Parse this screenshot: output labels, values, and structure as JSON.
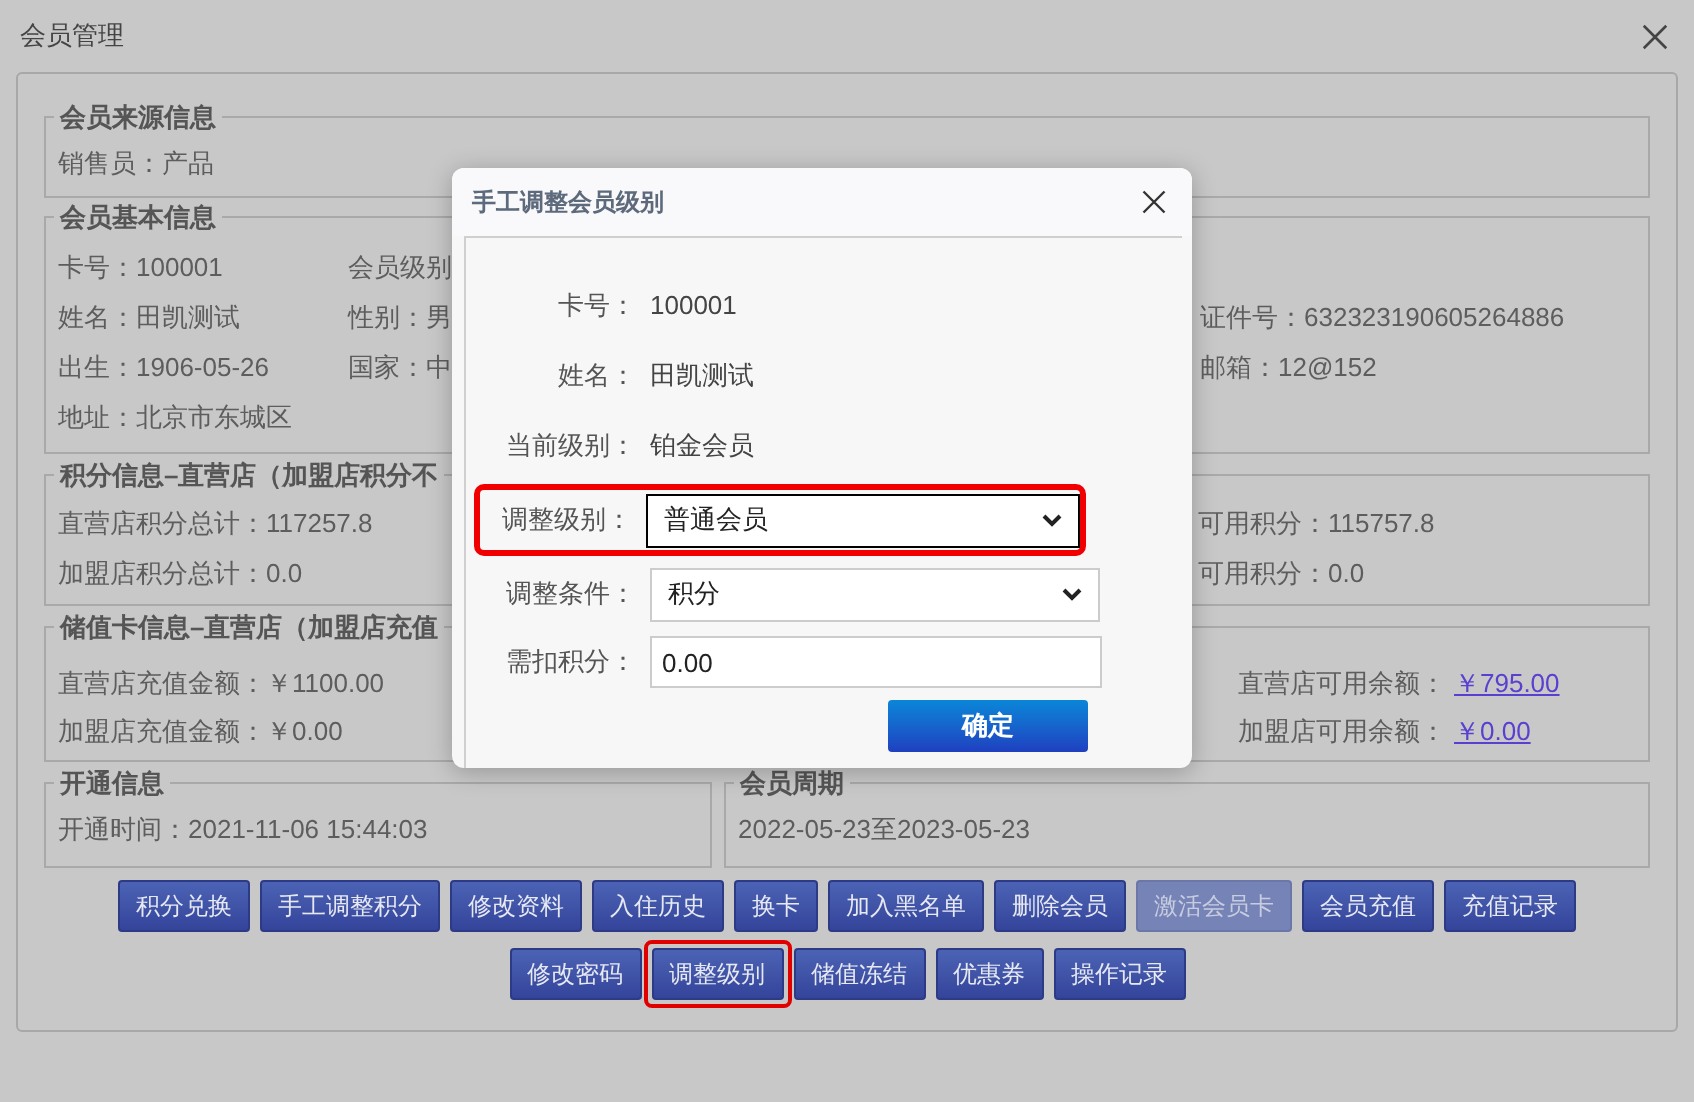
{
  "window": {
    "title": "会员管理"
  },
  "source_info": {
    "title": "会员来源信息",
    "rows": [
      {
        "left": "销售员：产品"
      }
    ]
  },
  "basic_info": {
    "title": "会员基本信息",
    "rows": [
      {
        "left": "卡号：100001",
        "middle": "会员级别"
      },
      {
        "left": "姓名：田凯测试",
        "middle": "性别：男",
        "right": "证件号：632323190605264886"
      },
      {
        "left": "出生：1906-05-26",
        "middle": "国家：中",
        "right": "邮箱：12@152"
      },
      {
        "left": "地址：北京市东城区"
      }
    ]
  },
  "points_info": {
    "title": "积分信息–直营店（加盟店积分不",
    "rows": [
      {
        "left": "直营店积分总计：117257.8",
        "right": "可用积分：115757.8"
      },
      {
        "left": "加盟店积分总计：0.0",
        "right": "可用积分：0.0"
      }
    ]
  },
  "stored_value_info": {
    "title": "储值卡信息–直营店（加盟店充值",
    "rows": [
      {
        "left": "直营店充值金额：￥1100.00",
        "right_label": "直营店可用余额：",
        "right_link": "￥795.00"
      },
      {
        "left": "加盟店充值金额：￥0.00",
        "right_label": "加盟店可用余额：",
        "right_link": "￥0.00"
      }
    ]
  },
  "open_info": {
    "title": "开通信息",
    "text": "开通时间：2021-11-06 15:44:03"
  },
  "period_info": {
    "title": "会员周期",
    "text": "2022-05-23至2023-05-23"
  },
  "button_rows": [
    [
      {
        "label": "积分兑换",
        "disabled": false,
        "highlighted": false
      },
      {
        "label": "手工调整积分",
        "disabled": false,
        "highlighted": false
      },
      {
        "label": "修改资料",
        "disabled": false,
        "highlighted": false
      },
      {
        "label": "入住历史",
        "disabled": false,
        "highlighted": false
      },
      {
        "label": "换卡",
        "disabled": false,
        "highlighted": false
      },
      {
        "label": "加入黑名单",
        "disabled": false,
        "highlighted": false
      },
      {
        "label": "删除会员",
        "disabled": false,
        "highlighted": false
      },
      {
        "label": "激活会员卡",
        "disabled": true,
        "highlighted": false
      },
      {
        "label": "会员充值",
        "disabled": false,
        "highlighted": false
      },
      {
        "label": "充值记录",
        "disabled": false,
        "highlighted": false
      }
    ],
    [
      {
        "label": "修改密码",
        "disabled": false,
        "highlighted": false
      },
      {
        "label": "调整级别",
        "disabled": false,
        "highlighted": true
      },
      {
        "label": "储值冻结",
        "disabled": false,
        "highlighted": false
      },
      {
        "label": "优惠券",
        "disabled": false,
        "highlighted": false
      },
      {
        "label": "操作记录",
        "disabled": false,
        "highlighted": false
      }
    ]
  ],
  "dialog": {
    "title": "手工调整会员级别",
    "fields": [
      {
        "kind": "text",
        "label": "卡号：",
        "value": "100001",
        "highlighted": false
      },
      {
        "kind": "text",
        "label": "姓名：",
        "value": "田凯测试",
        "highlighted": false
      },
      {
        "kind": "text",
        "label": "当前级别：",
        "value": "铂金会员",
        "highlighted": false
      },
      {
        "kind": "select",
        "label": "调整级别：",
        "value": "普通会员",
        "highlighted": true
      },
      {
        "kind": "select",
        "label": "调整条件：",
        "value": "积分",
        "highlighted": false
      },
      {
        "kind": "input",
        "label": "需扣积分：",
        "value": "0.00",
        "highlighted": false
      }
    ],
    "confirm": "确定"
  }
}
